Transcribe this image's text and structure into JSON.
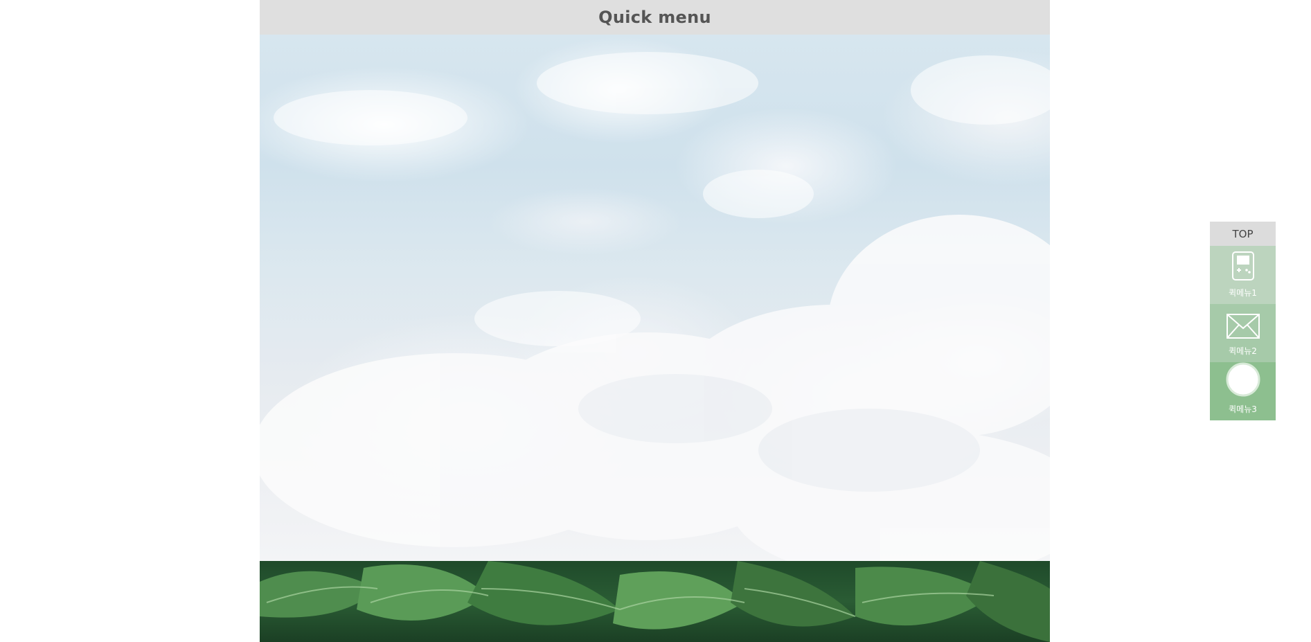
{
  "header": {
    "title": "Quick menu"
  },
  "quick_menu": {
    "top_label": "TOP",
    "items": [
      {
        "label": "퀵메뉴1",
        "icon": "gameboy-icon",
        "color": "#bcd4be"
      },
      {
        "label": "퀵메뉴2",
        "icon": "envelope-icon",
        "color": "#a6caa9"
      },
      {
        "label": "퀵메뉴3",
        "icon": "circle-icon",
        "color": "#8dbf8f"
      }
    ]
  },
  "content": {
    "images": [
      "sky-clouds-photo",
      "green-leaves-photo"
    ]
  }
}
